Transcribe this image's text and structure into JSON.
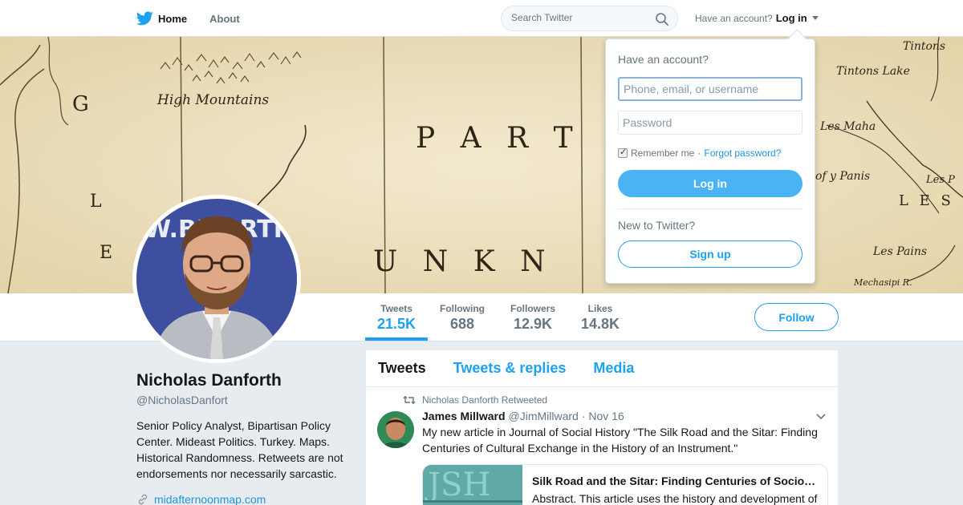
{
  "nav": {
    "home_label": "Home",
    "about_label": "About",
    "search_placeholder": "Search Twitter",
    "account_prompt": "Have an account?",
    "login_label": "Log in"
  },
  "banner": {
    "map_labels": [
      "High Mountains",
      "P A R T",
      "U N K N",
      "G",
      "L",
      "E",
      "Tintons",
      "Tintons Lake",
      "Les Maha",
      "of y Panis",
      "Les P",
      "L E S",
      "Les Pains",
      "Mechasipi R."
    ]
  },
  "profile_nav": {
    "stats": [
      {
        "label": "Tweets",
        "value": "21.5K"
      },
      {
        "label": "Following",
        "value": "688"
      },
      {
        "label": "Followers",
        "value": "12.9K"
      },
      {
        "label": "Likes",
        "value": "14.8K"
      }
    ],
    "follow_label": "Follow"
  },
  "profile": {
    "name": "Nicholas Danforth",
    "handle": "@NicholasDanfort",
    "bio": "Senior Policy Analyst, Bipartisan Policy Center. Mideast Politics. Turkey. Maps. Historical Randomness. Retweets are not endorsements nor necessarily sarcastic.",
    "url": "midafternoonmap.com",
    "avatar_backdrop_text": "W.BIPARTISA"
  },
  "timeline": {
    "tabs": [
      "Tweets",
      "Tweets & replies",
      "Media"
    ],
    "tweet": {
      "retweeted_by": "Nicholas Danforth Retweeted",
      "author_name": "James Millward",
      "author_handle": "@JimMillward",
      "date": "· Nov 16",
      "text": "My new article in Journal of Social History \"The Silk Road and the Sitar: Finding Centuries of Cultural Exchange in the History of an Instrument.\"",
      "card_title": "Silk Road and the Sitar: Finding Centuries of Socio…",
      "card_desc": "Abstract. This article uses the history and development of",
      "card_thumb_text": "JSH"
    }
  },
  "login_dropdown": {
    "title": "Have an account?",
    "username_placeholder": "Phone, email, or username",
    "password_placeholder": "Password",
    "remember_label": "Remember me",
    "separator": "·",
    "forgot_label": "Forgot password?",
    "login_button": "Log in",
    "new_label": "New to Twitter?",
    "signup_button": "Sign up"
  },
  "colors": {
    "brand": "#1da1f2",
    "banner_bg": "#efe4c6",
    "page_bg": "#e6ecf0"
  }
}
